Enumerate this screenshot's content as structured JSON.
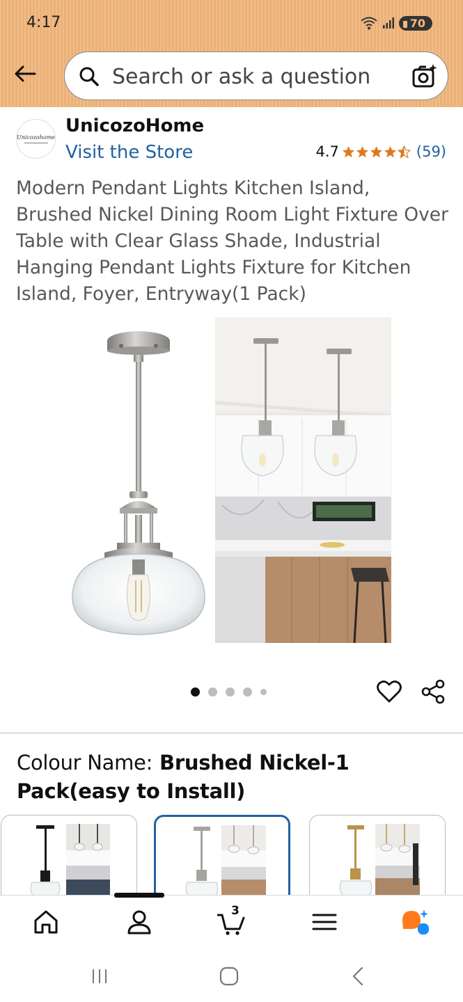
{
  "status_bar": {
    "time": "4:17",
    "battery": "70"
  },
  "header": {
    "search_placeholder": "Search or ask a question",
    "icons": [
      "back-arrow-icon",
      "search-icon",
      "camera-search-icon"
    ]
  },
  "store": {
    "logo_text": "Unicozohome",
    "name": "UnicozoHome",
    "visit_link": "Visit the Store",
    "rating": "4.7",
    "stars_filled": 4.5,
    "rating_count": "(59)"
  },
  "product": {
    "title": "Modern Pendant Lights Kitchen Island, Brushed Nickel Dining Room Light Fixture Over Table with Clear Glass Shade, Industrial Hanging Pendant Lights Fixture for Kitchen Island, Foyer, Entryway(1 Pack)",
    "image_count": 5,
    "active_image_index": 0
  },
  "variation": {
    "label": "Colour Name:",
    "selected_value": "Brushed Nickel-1 Pack(easy to Install)",
    "options": [
      {
        "finish": "black",
        "selected": false
      },
      {
        "finish": "brushed-nickel",
        "selected": true
      },
      {
        "finish": "brass",
        "selected": false
      }
    ]
  },
  "bottom_nav": {
    "items": [
      "home-icon",
      "account-icon",
      "cart-icon",
      "menu-icon",
      "rufus-ai-icon"
    ],
    "cart_count": "3"
  },
  "colors": {
    "header_bg": "#f2b87e",
    "link": "#2162a1",
    "star": "#de7921",
    "selected_border": "#2162a1",
    "ai_orange": "#ff7a1a",
    "ai_blue": "#1a8cff"
  }
}
